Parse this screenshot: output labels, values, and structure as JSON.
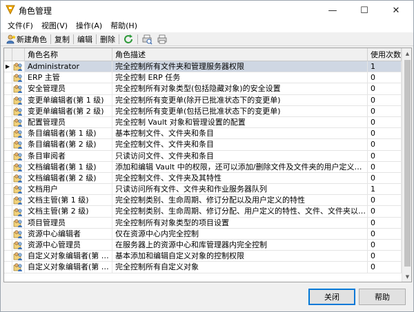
{
  "window": {
    "title": "角色管理"
  },
  "window_controls": {
    "minimize": "—",
    "maximize": "☐",
    "close": "✕"
  },
  "menu": [
    "文件(F)",
    "视图(V)",
    "操作(A)",
    "帮助(H)"
  ],
  "toolbar": {
    "new_role": "新建角色",
    "copy": "复制",
    "edit": "编辑",
    "delete": "删除"
  },
  "table": {
    "columns": [
      "角色名称",
      "角色描述",
      "使用次数"
    ],
    "rows": [
      {
        "name": "Administrator",
        "desc": "完全控制所有文件夹和管理服务器权限",
        "count": "1"
      },
      {
        "name": "ERP 主管",
        "desc": "完全控制 ERP 任务",
        "count": "0"
      },
      {
        "name": "安全管理员",
        "desc": "完全控制所有对象类型(包括隐藏对象)的安全设置",
        "count": "0"
      },
      {
        "name": "变更单编辑者(第 1 级)",
        "desc": "完全控制所有变更单(除开已批准状态下的变更单)",
        "count": "0"
      },
      {
        "name": "变更单编辑者(第 2 级)",
        "desc": "完全控制所有变更单(包括已批准状态下的变更单)",
        "count": "0"
      },
      {
        "name": "配置管理员",
        "desc": "完全控制 Vault 对象和管理设置的配置",
        "count": "0"
      },
      {
        "name": "条目编辑者(第 1 级)",
        "desc": "基本控制文件、文件夹和条目",
        "count": "0"
      },
      {
        "name": "条目编辑者(第 2 级)",
        "desc": "完全控制文件、文件夹和条目",
        "count": "0"
      },
      {
        "name": "条目审阅者",
        "desc": "只读访问文件、文件夹和条目",
        "count": "0"
      },
      {
        "name": "文档编辑者(第 1 级)",
        "desc": "添加和编辑 Vault 中的权限，还可以添加/删除文件及文件夹的用户定义特性",
        "count": "0"
      },
      {
        "name": "文档编辑者(第 2 级)",
        "desc": "完全控制文件、文件夹及其特性",
        "count": "0"
      },
      {
        "name": "文档用户",
        "desc": "只读访问所有文件、文件夹和作业服务器队列",
        "count": "1"
      },
      {
        "name": "文档主管(第 1 级)",
        "desc": "完全控制类别、生命周期、修订分配以及用户定义的特性",
        "count": "0"
      },
      {
        "name": "文档主管(第 2 级)",
        "desc": "完全控制类别、生命周期、修订分配、用户定义的特性、文件、文件夹以及自定义对...",
        "count": "0"
      },
      {
        "name": "项目管理员",
        "desc": "完全控制所有对象类型的项目设置",
        "count": "0"
      },
      {
        "name": "资源中心编辑者",
        "desc": "仅在资源中心内完全控制",
        "count": "0"
      },
      {
        "name": "资源中心管理员",
        "desc": "在服务器上的资源中心和库管理器内完全控制",
        "count": "0"
      },
      {
        "name": "自定义对象编辑者(第 1 级)",
        "desc": "基本添加和编辑自定义对象的控制权限",
        "count": "0"
      },
      {
        "name": "自定义对象编辑者(第 2 级)",
        "desc": "完全控制所有自定义对象",
        "count": "0"
      }
    ],
    "selected_index": 0
  },
  "buttons": {
    "close": "关闭",
    "help": "帮助"
  },
  "icons": [
    "app-icon",
    "new-role-icon",
    "refresh-icon",
    "print-preview-icon",
    "print-icon",
    "role-icon",
    "row-selector-arrow"
  ],
  "colors": {
    "selection": "#cfd7e3",
    "header": "#f0f0f0",
    "accent": "#0078d7"
  }
}
